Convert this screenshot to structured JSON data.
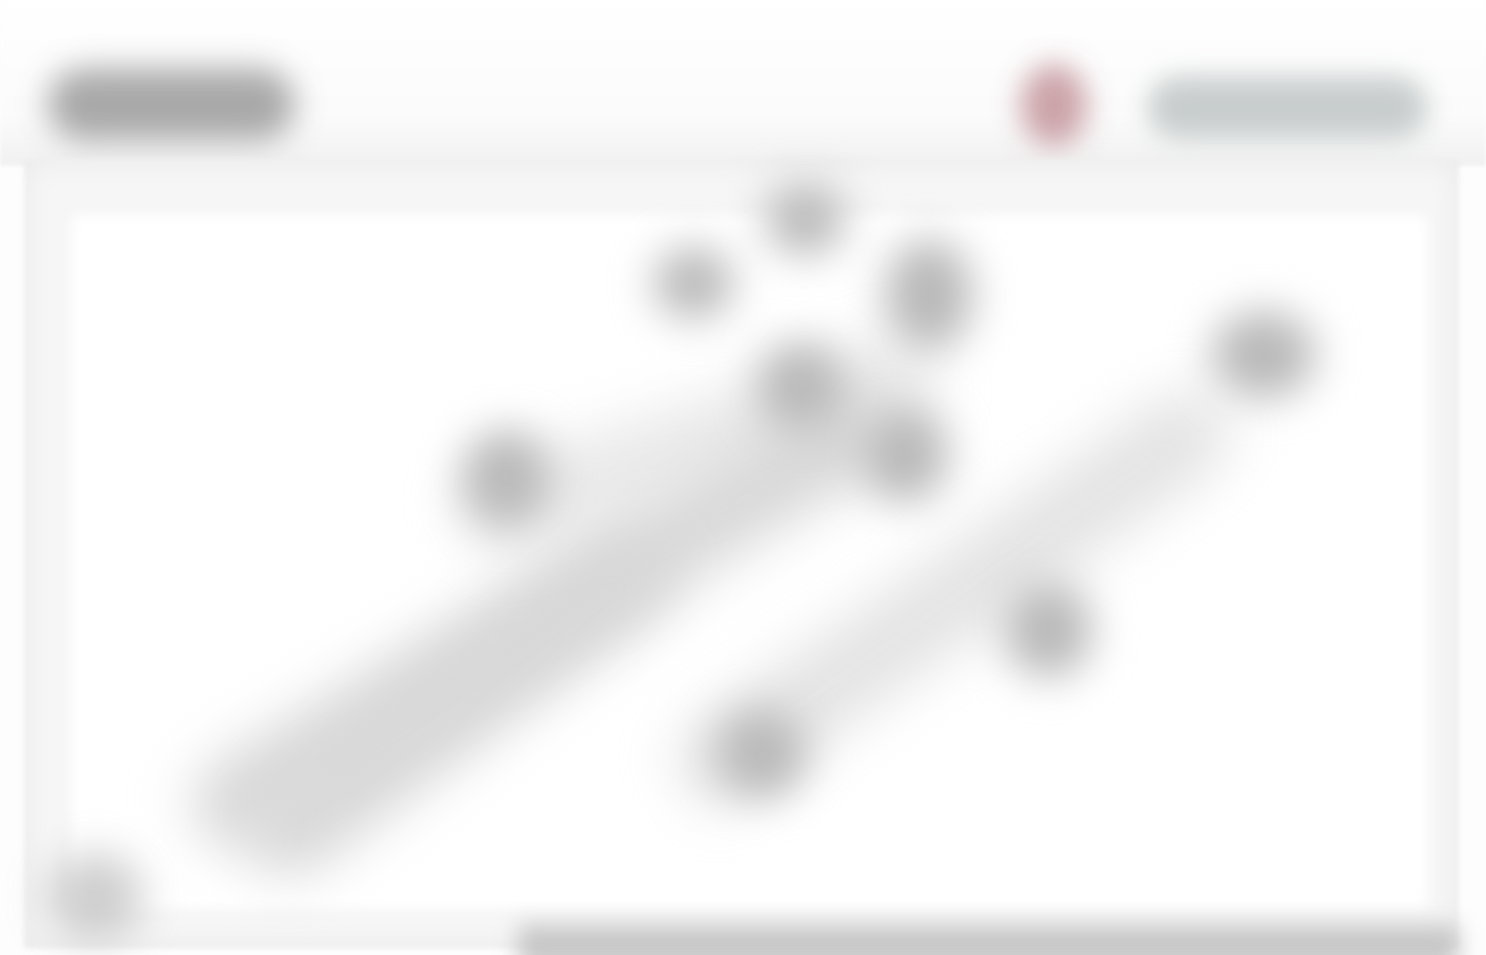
{
  "window": {
    "title": ""
  },
  "header": {
    "logo_icon": "app-logo-icon",
    "status_icon": "record-indicator-icon",
    "action_label": ""
  },
  "colors": {
    "background": "#ffffff",
    "header": "#fbfbfb",
    "logo": "#9a9a9a",
    "status": "#c69aa0",
    "action_pill": "#c8cdcd",
    "canvas_marks": "#b9b9b9"
  },
  "canvas": {
    "description_hidden": "",
    "marks_icon": "blurred-graph-marks-icon"
  },
  "footer": {
    "label": ""
  }
}
